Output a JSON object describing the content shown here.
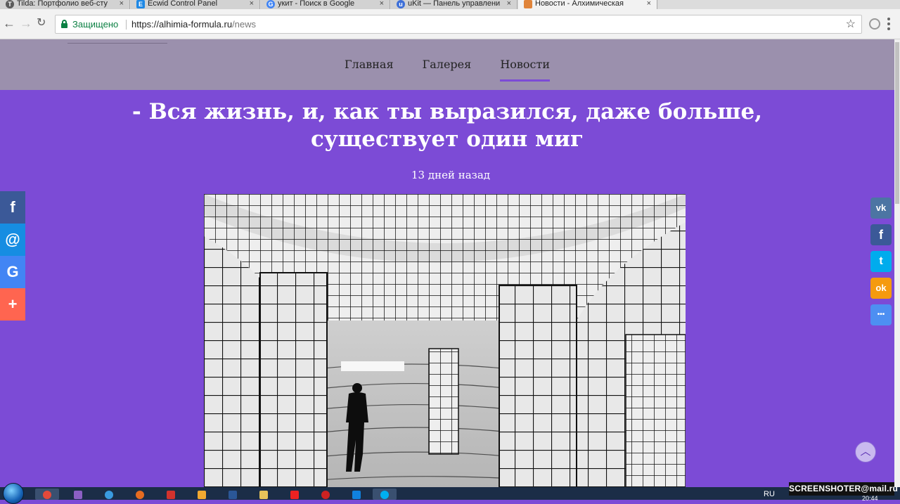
{
  "browser": {
    "tabs": [
      {
        "title": "Tilda: Портфолио веб-сту",
        "icon": "tilda-icon",
        "color": "#5b5b5b"
      },
      {
        "title": "Ecwid Control Panel",
        "icon": "ecwid-icon",
        "color": "#1e88e5"
      },
      {
        "title": "укит - Поиск в Google",
        "icon": "google-icon",
        "color": "#4285f4"
      },
      {
        "title": "uKit — Панель управлени",
        "icon": "ukit-icon",
        "color": "#3d6fd8"
      },
      {
        "title": "Новости - Алхимическая",
        "icon": "site-icon",
        "color": "#e0843a"
      }
    ],
    "secure_label": "Защищено",
    "url_host": "https://alhimia-formula.ru",
    "url_path": "/news"
  },
  "site": {
    "nav": [
      {
        "label": "Главная",
        "active": false
      },
      {
        "label": "Галерея",
        "active": false
      },
      {
        "label": "Новости",
        "active": true
      }
    ],
    "accent": "#7c4bd6",
    "header_bg": "#9b90ad"
  },
  "post": {
    "title": "- Вся жизнь, и, как ты выразился, даже больше, существует один миг",
    "date": "13 дней назад",
    "image_alt": "optical illusion room with warped grid"
  },
  "share_left": [
    {
      "icon": "facebook-icon",
      "glyph": "f",
      "color": "#3b5998"
    },
    {
      "icon": "mail-ru-icon",
      "glyph": "@",
      "color": "#168de2"
    },
    {
      "icon": "google-icon",
      "glyph": "G",
      "color": "#4285f4"
    },
    {
      "icon": "plus-icon",
      "glyph": "+",
      "color": "#ff6550"
    }
  ],
  "share_right": [
    {
      "icon": "vk-icon",
      "glyph": "vk",
      "color": "#4c75a3"
    },
    {
      "icon": "facebook-icon",
      "glyph": "f",
      "color": "#3b5998"
    },
    {
      "icon": "twitter-icon",
      "glyph": "t",
      "color": "#00aced"
    },
    {
      "icon": "odnoklassniki-icon",
      "glyph": "ok",
      "color": "#f59a0e"
    },
    {
      "icon": "more-icon",
      "glyph": "•••",
      "color": "#4d8ff2"
    }
  ],
  "taskbar": {
    "lang": "RU",
    "watermark": "SCREENSHOTER@mail.ru",
    "time": "20:44"
  }
}
